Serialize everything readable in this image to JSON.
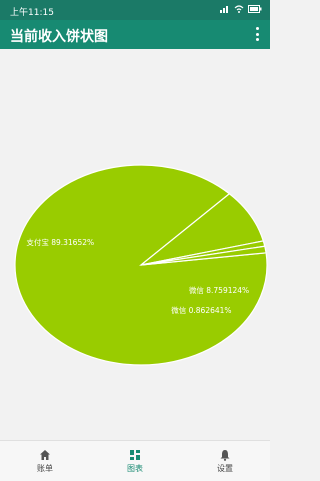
{
  "status_bar": {
    "time": "上午11:15"
  },
  "app_bar": {
    "title": "当前收入饼状图"
  },
  "chart_data": {
    "type": "pie",
    "title": "",
    "slices": [
      {
        "label": "支付宝",
        "value": 89.31652,
        "display": "支付宝 89.31652%",
        "color": "#99cc00"
      },
      {
        "label": "微信",
        "value": 8.759124,
        "display": "微信 8.759124%",
        "color": "#99cc00"
      },
      {
        "label": "微信",
        "value": 0.862641,
        "display": "微信 0.862641%",
        "color": "#99cc00"
      },
      {
        "label": "",
        "value": 1.061715,
        "display": "",
        "color": "#99cc00"
      }
    ]
  },
  "bottom_nav": [
    {
      "label": "账单",
      "icon": "home-icon",
      "active": false
    },
    {
      "label": "图表",
      "icon": "chart-icon",
      "active": true
    },
    {
      "label": "设置",
      "icon": "bell-icon",
      "active": false
    }
  ]
}
